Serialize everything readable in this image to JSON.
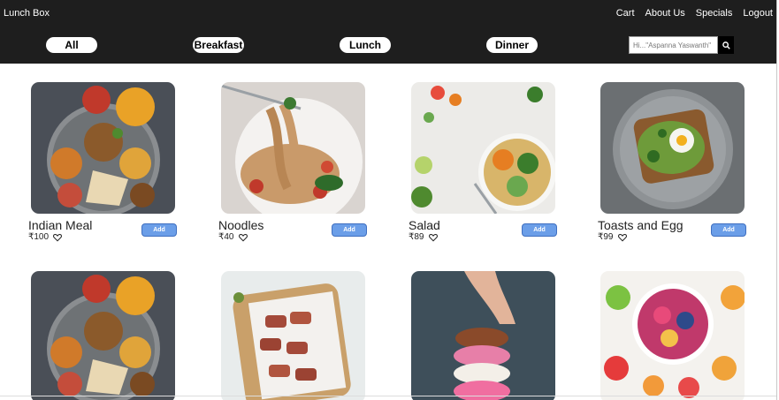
{
  "header": {
    "brand": "Lunch Box",
    "nav": [
      "Cart",
      "About Us",
      "Specials",
      "Logout"
    ]
  },
  "filters": [
    "All",
    "Breakfast",
    "Lunch",
    "Dinner"
  ],
  "search": {
    "placeholder": "Hi...\"Aspanna Yaswanth\"",
    "icon": "search-icon"
  },
  "products": [
    {
      "name": "Indian Meal",
      "price": "₹100",
      "add_label": "Add"
    },
    {
      "name": "Noodles",
      "price": "₹40",
      "add_label": "Add"
    },
    {
      "name": "Salad",
      "price": "₹89",
      "add_label": "Add"
    },
    {
      "name": "Toasts and Egg",
      "price": "₹99",
      "add_label": "Add"
    }
  ],
  "colors": {
    "header_bg": "#1e1e1e",
    "add_button": "#6b9ee8"
  }
}
